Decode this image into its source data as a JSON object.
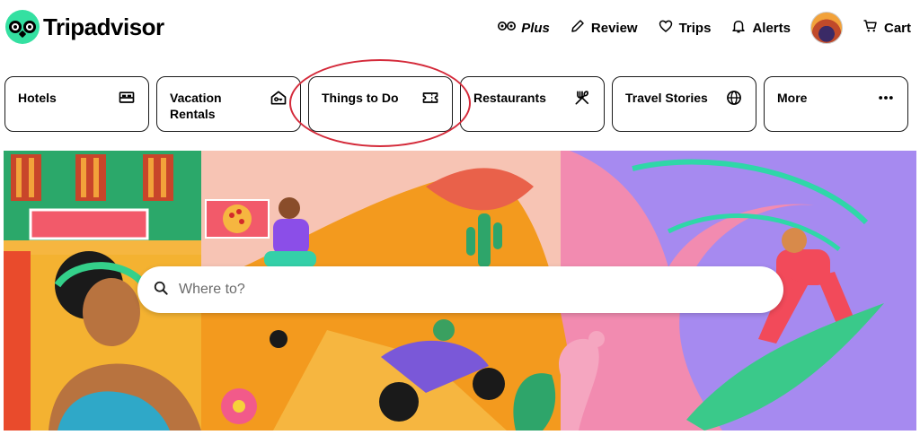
{
  "brand": {
    "name": "Tripadvisor",
    "logo_icon": "owl-eyes-icon",
    "color": "#34e0a1"
  },
  "top_nav": {
    "plus_label": "Plus",
    "review_label": "Review",
    "trips_label": "Trips",
    "alerts_label": "Alerts",
    "cart_label": "Cart"
  },
  "categories": [
    {
      "label": "Hotels",
      "icon": "bed-icon"
    },
    {
      "label": "Vacation Rentals",
      "icon": "house-key-icon"
    },
    {
      "label": "Things to Do",
      "icon": "ticket-icon"
    },
    {
      "label": "Restaurants",
      "icon": "fork-knife-icon"
    },
    {
      "label": "Travel Stories",
      "icon": "globe-icon"
    },
    {
      "label": "More",
      "icon": "more-dots-icon"
    }
  ],
  "highlight": {
    "target": "Things to Do",
    "color": "#d42a3a"
  },
  "search": {
    "placeholder": "Where to?"
  }
}
